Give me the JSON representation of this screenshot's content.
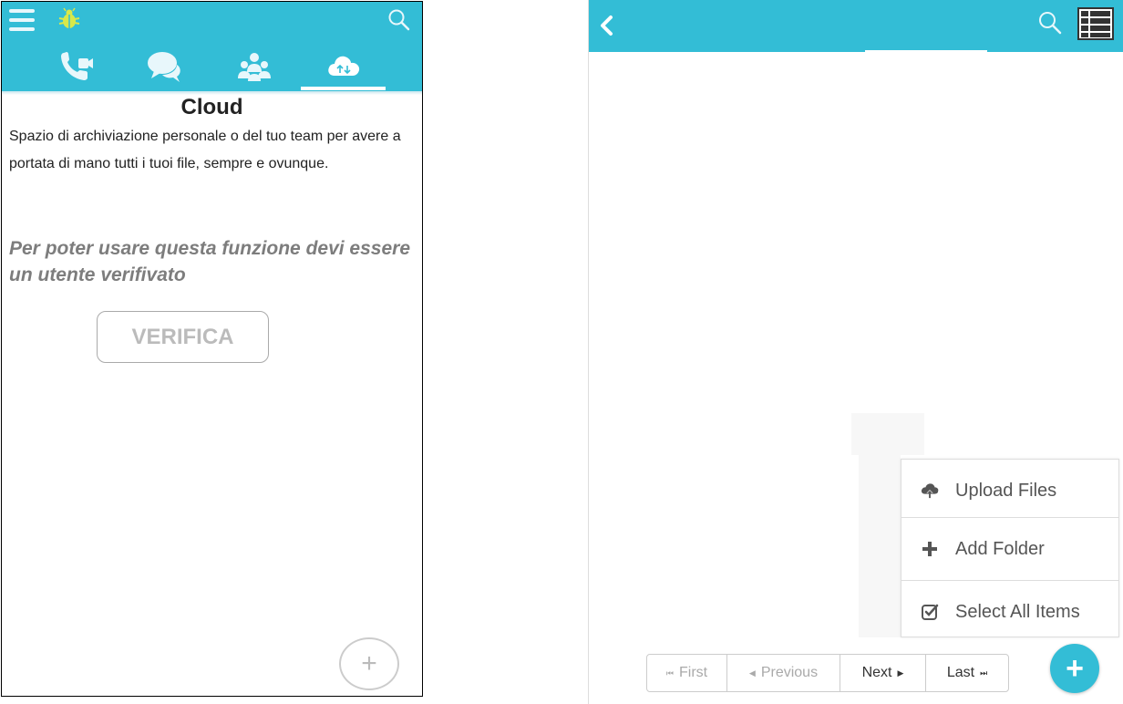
{
  "left": {
    "header": {
      "tabs": [
        {
          "icon": "video-call-icon"
        },
        {
          "icon": "chat-icon"
        },
        {
          "icon": "group-icon"
        },
        {
          "icon": "cloud-sync-icon",
          "active": true
        }
      ]
    },
    "content": {
      "title": "Cloud",
      "description": "Spazio di archiviazione personale o del tuo team per avere a portata di mano tutti i tuoi file, sempre e ovunque.",
      "verify_message": "Per poter usare questa funzione devi essere un utente verifivato",
      "verify_button": "VERIFICA"
    },
    "fab_label": "+"
  },
  "right": {
    "menu": {
      "items": [
        {
          "label": "Upload Files",
          "icon": "cloud-upload-icon"
        },
        {
          "label": "Add Folder",
          "icon": "plus-icon"
        },
        {
          "label": "Select All Items",
          "icon": "checkbox-icon"
        }
      ]
    },
    "pagination": {
      "first": "First",
      "previous": "Previous",
      "next": "Next",
      "last": "Last"
    },
    "fab_label": "+"
  },
  "colors": {
    "accent": "#33bdd6",
    "disabled_text": "#aaaaaa",
    "muted_text": "#7d7d7d"
  }
}
